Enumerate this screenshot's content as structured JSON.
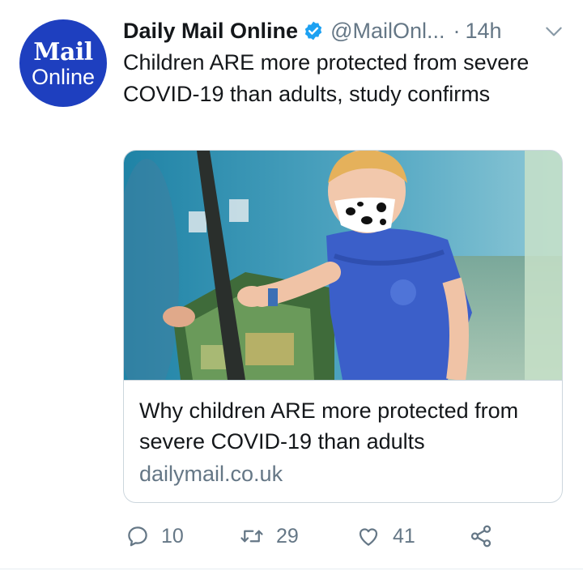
{
  "account": {
    "avatar_top": "Mail",
    "avatar_bottom": "Online",
    "display_name": "Daily Mail Online",
    "handle": "@MailOnl...",
    "separator": "·",
    "time": "14h"
  },
  "tweet": {
    "text": "Children ARE more protected from severe COVID-19 than adults, study confirms"
  },
  "card": {
    "title": "Why children ARE more protected from severe COVID-19 than adults",
    "domain": "dailymail.co.uk",
    "image_icon": "photo-of-masked-child"
  },
  "actions": {
    "reply_count": "10",
    "retweet_count": "29",
    "like_count": "41"
  },
  "colors": {
    "brand": "#1e3fbf",
    "verified": "#1da1f2",
    "muted": "#657786",
    "text": "#14171a"
  }
}
